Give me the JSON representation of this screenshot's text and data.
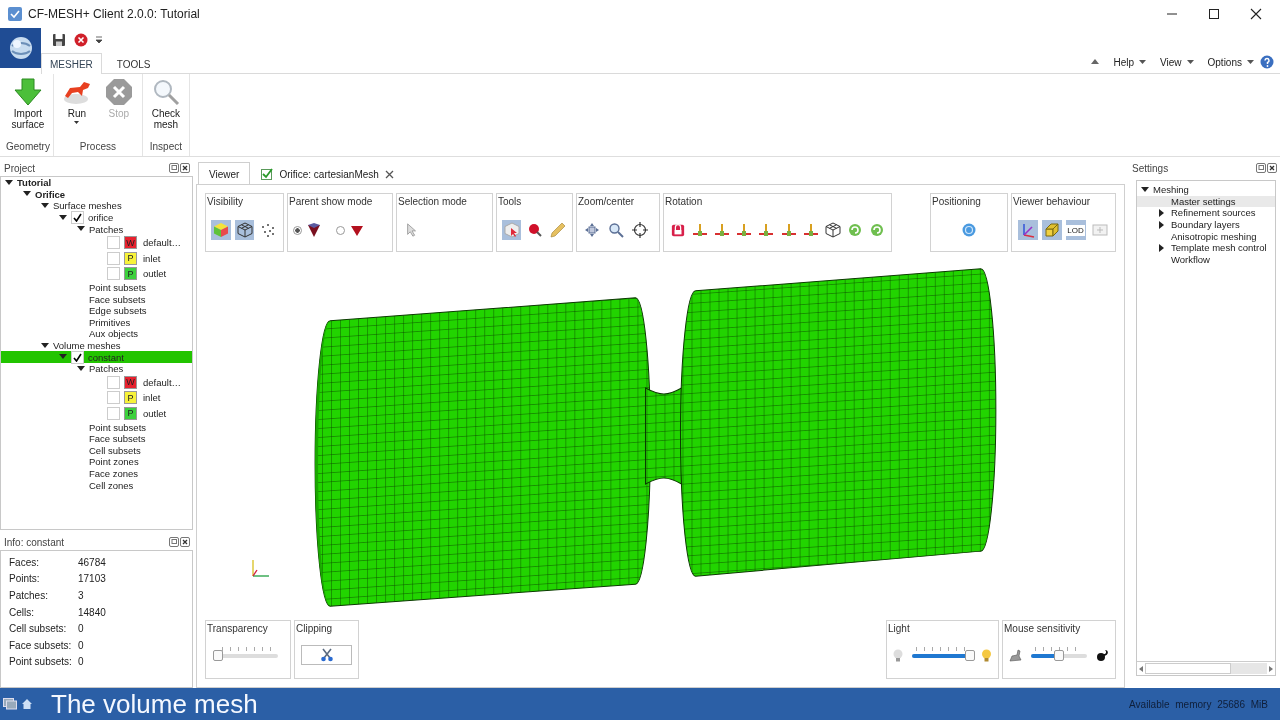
{
  "window": {
    "title": "CF-MESH+ Client 2.0.0: Tutorial"
  },
  "ribbon_tabs": [
    {
      "label": "MESHER",
      "selected": true
    },
    {
      "label": "TOOLS",
      "selected": false
    }
  ],
  "menu": [
    {
      "label": "Help"
    },
    {
      "label": "View"
    },
    {
      "label": "Options"
    }
  ],
  "ribbon_groups": [
    {
      "caption": "Geometry",
      "buttons": [
        {
          "label": "Import surface",
          "disabled": false,
          "dropdown": false
        }
      ]
    },
    {
      "caption": "Process",
      "buttons": [
        {
          "label": "Run",
          "disabled": false,
          "dropdown": true
        },
        {
          "label": "Stop",
          "disabled": true,
          "dropdown": false
        }
      ]
    },
    {
      "caption": "Inspect",
      "buttons": [
        {
          "label": "Check mesh",
          "disabled": false,
          "dropdown": false
        }
      ]
    }
  ],
  "project_panel": {
    "title": "Project",
    "tree": [
      {
        "label": "Tutorial",
        "bold": true,
        "expanded": true,
        "selected": false,
        "children": [
          {
            "label": "Orifice",
            "bold": true,
            "expanded": true,
            "selected": false,
            "children": [
              {
                "label": "Surface meshes",
                "bold": false,
                "expanded": true,
                "selected": false,
                "children": [
                  {
                    "label": "orifice",
                    "bold": false,
                    "checked": true,
                    "expanded": true,
                    "selected": false,
                    "children": [
                      {
                        "label": "Patches",
                        "bold": false,
                        "expanded": true,
                        "selected": false,
                        "children": [
                          {
                            "label": "default…",
                            "badge": "W",
                            "color": "#e8212e",
                            "checked": false,
                            "selected": false
                          },
                          {
                            "label": "inlet",
                            "badge": "P",
                            "color": "#f7f23a",
                            "checked": false,
                            "selected": false
                          },
                          {
                            "label": "outlet",
                            "badge": "P",
                            "color": "#3dd13d",
                            "checked": false,
                            "selected": false
                          }
                        ]
                      },
                      {
                        "label": "Point subsets",
                        "bold": false,
                        "selected": false
                      },
                      {
                        "label": "Face subsets",
                        "bold": false,
                        "selected": false
                      },
                      {
                        "label": "Edge subsets",
                        "bold": false,
                        "selected": false
                      },
                      {
                        "label": "Primitives",
                        "bold": false,
                        "selected": false
                      },
                      {
                        "label": "Aux objects",
                        "bold": false,
                        "selected": false
                      }
                    ]
                  }
                ]
              },
              {
                "label": "Volume meshes",
                "bold": false,
                "expanded": true,
                "selected": false,
                "children": [
                  {
                    "label": "constant",
                    "bold": false,
                    "checked": true,
                    "expanded": true,
                    "selected": true,
                    "children": [
                      {
                        "label": "Patches",
                        "bold": false,
                        "expanded": true,
                        "selected": false,
                        "children": [
                          {
                            "label": "default…",
                            "badge": "W",
                            "color": "#e8212e",
                            "checked": false,
                            "selected": false
                          },
                          {
                            "label": "inlet",
                            "badge": "P",
                            "color": "#f7f23a",
                            "checked": false,
                            "selected": false
                          },
                          {
                            "label": "outlet",
                            "badge": "P",
                            "color": "#3dd13d",
                            "checked": false,
                            "selected": false
                          }
                        ]
                      },
                      {
                        "label": "Point subsets",
                        "bold": false,
                        "selected": false
                      },
                      {
                        "label": "Face subsets",
                        "bold": false,
                        "selected": false
                      },
                      {
                        "label": "Cell subsets",
                        "bold": false,
                        "selected": false
                      },
                      {
                        "label": "Point zones",
                        "bold": false,
                        "selected": false
                      },
                      {
                        "label": "Face zones",
                        "bold": false,
                        "selected": false
                      },
                      {
                        "label": "Cell zones",
                        "bold": false,
                        "selected": false
                      }
                    ]
                  }
                ]
              }
            ]
          }
        ]
      }
    ]
  },
  "info_panel": {
    "title": "Info: constant",
    "rows": [
      {
        "label": "Faces:",
        "value": "46784"
      },
      {
        "label": "Points:",
        "value": "17103"
      },
      {
        "label": "Patches:",
        "value": "3"
      },
      {
        "label": "Cells:",
        "value": "14840"
      },
      {
        "label": "Cell subsets:",
        "value": "0"
      },
      {
        "label": "Face subsets:",
        "value": "0"
      },
      {
        "label": "Point subsets:",
        "value": "0"
      }
    ]
  },
  "viewer": {
    "tabs": [
      {
        "kind": "viewer",
        "label": "Viewer",
        "selected": true
      },
      {
        "kind": "mesh",
        "label": "Orifice: cartesianMesh",
        "selected": false
      }
    ],
    "toolbar": [
      {
        "title": "Visibility",
        "buttons": [
          {
            "kind": "toggle",
            "pressed": true
          },
          {
            "kind": "toggle",
            "pressed": true
          },
          {
            "kind": "toggle",
            "pressed": false
          }
        ]
      },
      {
        "title": "Parent show mode",
        "buttons": [
          {
            "kind": "radio",
            "selected": true
          },
          {
            "kind": "radio",
            "selected": false
          }
        ]
      },
      {
        "title": "Selection mode",
        "buttons": [
          {
            "kind": "action"
          }
        ]
      },
      {
        "title": "Tools",
        "buttons": [
          {
            "kind": "toggle",
            "pressed": true
          },
          {
            "kind": "action"
          },
          {
            "kind": "action"
          }
        ]
      },
      {
        "title": "Zoom/center",
        "buttons": [
          {
            "kind": "action"
          },
          {
            "kind": "action"
          },
          {
            "kind": "action"
          }
        ]
      },
      {
        "title": "Rotation",
        "buttons": [
          {
            "kind": "action"
          },
          {
            "kind": "action"
          },
          {
            "kind": "action"
          },
          {
            "kind": "action"
          },
          {
            "kind": "action"
          },
          {
            "kind": "action"
          },
          {
            "kind": "action"
          },
          {
            "kind": "action"
          },
          {
            "kind": "action"
          },
          {
            "kind": "action"
          }
        ]
      },
      {
        "title": "Positioning",
        "buttons": [
          {
            "kind": "action"
          }
        ]
      },
      {
        "title": "Viewer behaviour",
        "buttons": [
          {
            "kind": "toggle",
            "pressed": true
          },
          {
            "kind": "toggle",
            "pressed": true
          },
          {
            "kind": "toggle",
            "pressed": true,
            "label": "LOD"
          },
          {
            "kind": "action"
          }
        ]
      }
    ],
    "bottom_toolbar": [
      {
        "title": "Transparency",
        "kind": "slider",
        "level": 0.0
      },
      {
        "title": "Clipping",
        "kind": "button"
      },
      {
        "title": "Light",
        "kind": "slider",
        "level": 0.96
      },
      {
        "title": "Mouse sensitivity",
        "kind": "slider",
        "level": 0.5
      }
    ]
  },
  "settings_panel": {
    "title": "Settings",
    "tree": [
      {
        "label": "Meshing",
        "expanded": true,
        "selected": false,
        "children": [
          {
            "label": "Master settings",
            "selected": true
          },
          {
            "label": "Refinement sources",
            "expanded": false,
            "selected": false
          },
          {
            "label": "Boundary layers",
            "expanded": false,
            "selected": false
          },
          {
            "label": "Anisotropic meshing",
            "selected": false
          },
          {
            "label": "Template mesh control",
            "expanded": false,
            "selected": false
          },
          {
            "label": "Workflow",
            "selected": false
          }
        ]
      }
    ]
  },
  "status_bar": {
    "caption": "The volume mesh",
    "memory": "Available memory 25686 MiB"
  }
}
